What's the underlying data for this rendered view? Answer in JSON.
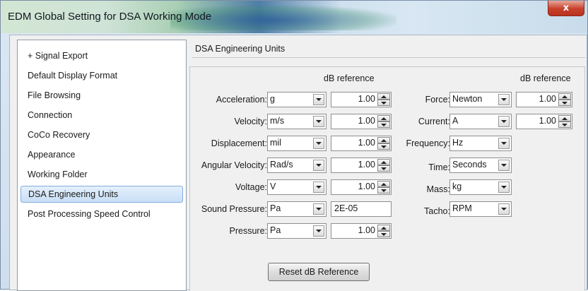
{
  "window": {
    "title": "EDM Global Setting for DSA Working Mode",
    "close_glyph": "x"
  },
  "sidebar": {
    "items": [
      {
        "label": "+ Signal Export"
      },
      {
        "label": "Default Display Format"
      },
      {
        "label": "File Browsing"
      },
      {
        "label": "Connection"
      },
      {
        "label": "CoCo Recovery"
      },
      {
        "label": "Appearance"
      },
      {
        "label": "Working Folder"
      },
      {
        "label": "DSA Engineering Units",
        "selected": true
      },
      {
        "label": "Post Processing Speed Control"
      }
    ]
  },
  "panel": {
    "header": "DSA Engineering Units",
    "db_reference_header": "dB reference",
    "left_units": [
      {
        "label": "Acceleration:",
        "unit": "g",
        "db_ref": "1.00"
      },
      {
        "label": "Velocity:",
        "unit": "m/s",
        "db_ref": "1.00"
      },
      {
        "label": "Displacement:",
        "unit": "mil",
        "db_ref": "1.00"
      },
      {
        "label": "Angular Velocity:",
        "unit": "Rad/s",
        "db_ref": "1.00"
      },
      {
        "label": "Voltage:",
        "unit": "V",
        "db_ref": "1.00"
      },
      {
        "label": "Sound Pressure:",
        "unit": "Pa",
        "db_ref": "2E-05"
      },
      {
        "label": "Pressure:",
        "unit": "Pa",
        "db_ref": "1.00"
      }
    ],
    "right_units": [
      {
        "label": "Force:",
        "unit": "Newton",
        "db_ref": "1.00"
      },
      {
        "label": "Current:",
        "unit": "A",
        "db_ref": "1.00"
      },
      {
        "label": "Frequency:",
        "unit": "Hz"
      },
      {
        "label": "Time:",
        "unit": "Seconds"
      },
      {
        "label": "Mass:",
        "unit": "kg"
      },
      {
        "label": "Tacho:",
        "unit": "RPM"
      }
    ],
    "reset_button": "Reset dB Reference"
  }
}
